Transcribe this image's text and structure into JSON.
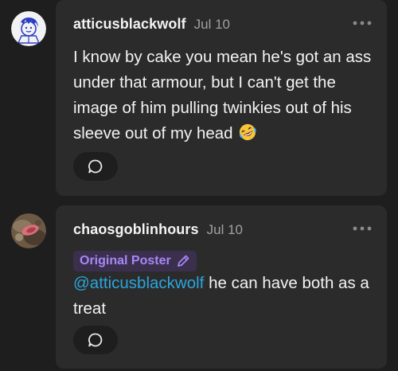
{
  "comments": [
    {
      "author": "atticusblackwolf",
      "date": "Jul 10",
      "text": "I know by cake you mean he's got an ass under that armour, but I can't get the image of him pulling twinkies out of his sleeve out of my head",
      "emoji": "rolling-on-floor-laughing-emoji",
      "more_icon": "ellipsis-icon",
      "reply_icon": "comment-bubble-icon"
    },
    {
      "author": "chaosgoblinhours",
      "date": "Jul 10",
      "badge": "Original Poster",
      "badge_icon": "pencil-icon",
      "mention": "@atticusblackwolf",
      "text": " he can have both as a treat",
      "more_icon": "ellipsis-icon",
      "reply_icon": "comment-bubble-icon"
    }
  ],
  "colors": {
    "background": "#1e1e1e",
    "card": "#2b2b2b",
    "mention": "#2aa6dd",
    "badge_text": "#a887f5",
    "badge_bg": "#3a304d"
  }
}
